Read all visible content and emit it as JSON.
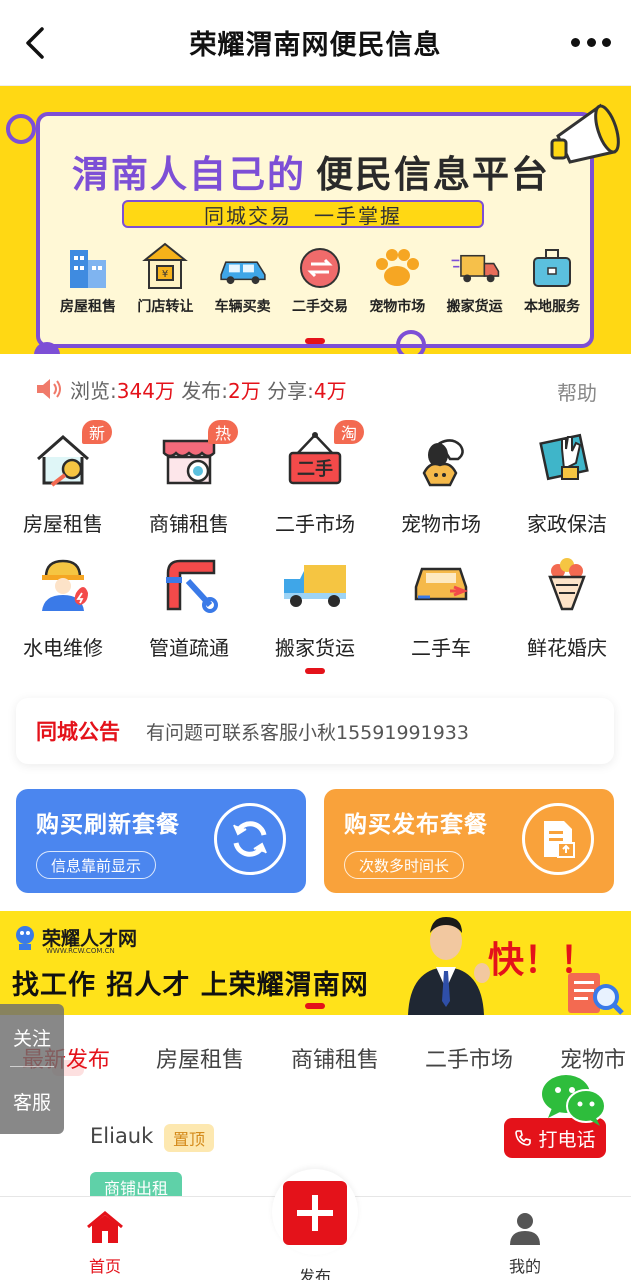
{
  "header": {
    "title": "荣耀渭南网便民信息"
  },
  "banner": {
    "heading_part1": "渭南人自己的",
    "heading_part2": "便民信息平台",
    "subtitle": "同城交易　一手掌握",
    "categories": [
      {
        "label": "房屋租售",
        "icon": "building-icon"
      },
      {
        "label": "门店转让",
        "icon": "shop-icon"
      },
      {
        "label": "车辆买卖",
        "icon": "car-icon"
      },
      {
        "label": "二手交易",
        "icon": "exchange-icon"
      },
      {
        "label": "宠物市场",
        "icon": "paw-icon"
      },
      {
        "label": "搬家货运",
        "icon": "truck-icon"
      },
      {
        "label": "本地服务",
        "icon": "toolbox-icon"
      }
    ]
  },
  "stats": {
    "views_label": "浏览:",
    "views_value": "344万",
    "posts_label": "发布:",
    "posts_value": "2万",
    "shares_label": "分享:",
    "shares_value": "4万",
    "help_label": "帮助"
  },
  "grid": [
    {
      "label": "房屋租售",
      "icon": "house-key-icon",
      "tag": "新"
    },
    {
      "label": "商铺租售",
      "icon": "store-icon",
      "tag": "热"
    },
    {
      "label": "二手市场",
      "icon": "secondhand-sign-icon",
      "tag": "淘"
    },
    {
      "label": "宠物市场",
      "icon": "pet-icon",
      "tag": ""
    },
    {
      "label": "家政保洁",
      "icon": "cleaning-glove-icon",
      "tag": ""
    },
    {
      "label": "水电维修",
      "icon": "electrician-icon",
      "tag": ""
    },
    {
      "label": "管道疏通",
      "icon": "pipe-wrench-icon",
      "tag": ""
    },
    {
      "label": "搬家货运",
      "icon": "moving-truck-icon",
      "tag": ""
    },
    {
      "label": "二手车",
      "icon": "used-car-icon",
      "tag": ""
    },
    {
      "label": "鲜花婚庆",
      "icon": "flower-bouquet-icon",
      "tag": ""
    }
  ],
  "notice": {
    "title": "同城公告",
    "content": "有问题可联系客服小秋15591991933"
  },
  "packages": {
    "refresh_title": "购买刷新套餐",
    "refresh_sub": "信息靠前显示",
    "publish_title": "购买发布套餐",
    "publish_sub": "次数多时间长"
  },
  "recruit": {
    "logo_text": "荣耀人才网",
    "logo_url": "WWW.RCW.COM.CN",
    "slogan": "找工作 招人才 上荣耀渭南网",
    "fast": "快！！"
  },
  "tabs": [
    "最新发布",
    "房屋租售",
    "商铺租售",
    "二手市场",
    "宠物市"
  ],
  "side": {
    "follow": "关注",
    "service": "客服"
  },
  "post": {
    "user": "Eliauk",
    "top_badge": "置顶",
    "call_label": "打电话",
    "category": "商铺出租"
  },
  "bottom_nav": {
    "home": "首页",
    "publish": "发布",
    "me": "我的"
  },
  "colors": {
    "accent_red": "#e4121a",
    "banner_yellow": "#ffd814",
    "banner_purple": "#7d4fd6",
    "package_blue": "#4b86ef",
    "package_orange": "#f9a23b"
  }
}
